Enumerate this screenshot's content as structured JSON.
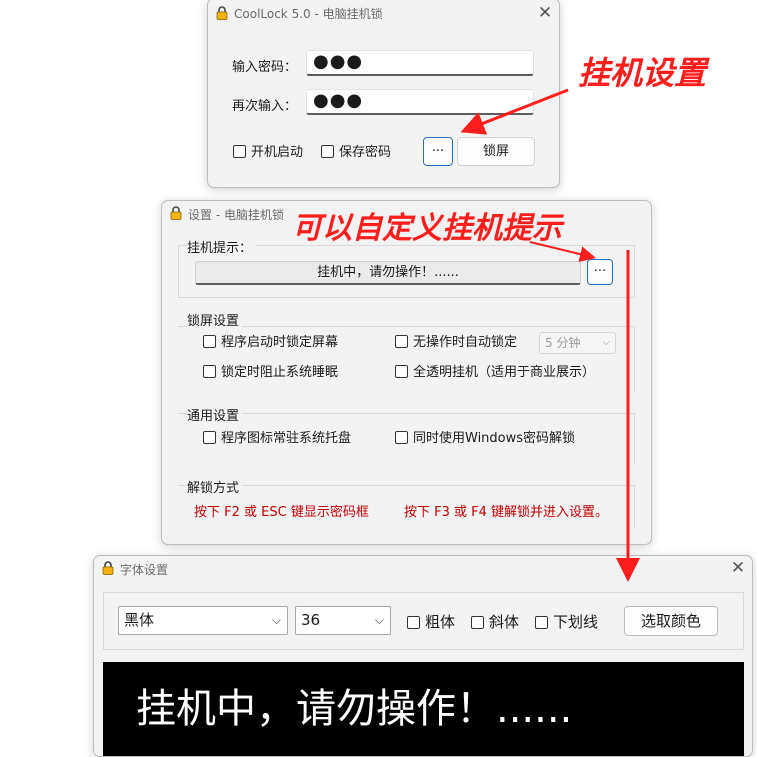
{
  "main_window": {
    "title": "CoolLock 5.0 - 电脑挂机锁",
    "close_glyph": "✕",
    "password_label": "输入密码：",
    "password_value": "●●●",
    "confirm_label": "再次输入：",
    "confirm_value": "●●●",
    "autostart_label": "开机启动",
    "save_password_label": "保存密码",
    "settings_button_label": "···",
    "lock_button_label": "锁屏"
  },
  "settings_window": {
    "title": "设置 - 电脑挂机锁",
    "hint_group_label": "挂机提示：",
    "hint_text": "挂机中，请勿操作！......",
    "hint_edit_button_label": "···",
    "lock_group_label": "锁屏设置",
    "lock_options": {
      "lock_on_start": "程序启动时锁定屏幕",
      "auto_lock_idle": "无操作时自动锁定",
      "idle_time": "5 分钟",
      "prevent_sleep": "锁定时阻止系统睡眠",
      "transparent": "全透明挂机（适用于商业展示）"
    },
    "general_group_label": "通用设置",
    "general_options": {
      "tray_icon": "程序图标常驻系统托盘",
      "windows_password": "同时使用Windows密码解锁"
    },
    "unlock_group_label": "解锁方式",
    "unlock_hint_1": "按下 F2 或 ESC 键显示密码框",
    "unlock_hint_2": "按下 F3 或 F4 键解锁并进入设置。"
  },
  "font_window": {
    "title": "字体设置",
    "close_glyph": "✕",
    "font_name": "黑体",
    "font_size": "36",
    "bold_label": "粗体",
    "italic_label": "斜体",
    "underline_label": "下划线",
    "color_button_label": "选取颜色",
    "preview_text": "挂机中，请勿操作！......"
  },
  "annotations": {
    "lock_settings": "挂机设置",
    "custom_hint": "可以自定义挂机提示"
  },
  "colors": {
    "annotation": "#ff1e1e",
    "accent": "#2f6fbf",
    "unlock_text": "#c00000",
    "preview_bg": "#000000"
  },
  "icons": {
    "app": "padlock-icon",
    "close": "close-icon",
    "dropdown": "chevron-down-icon"
  }
}
